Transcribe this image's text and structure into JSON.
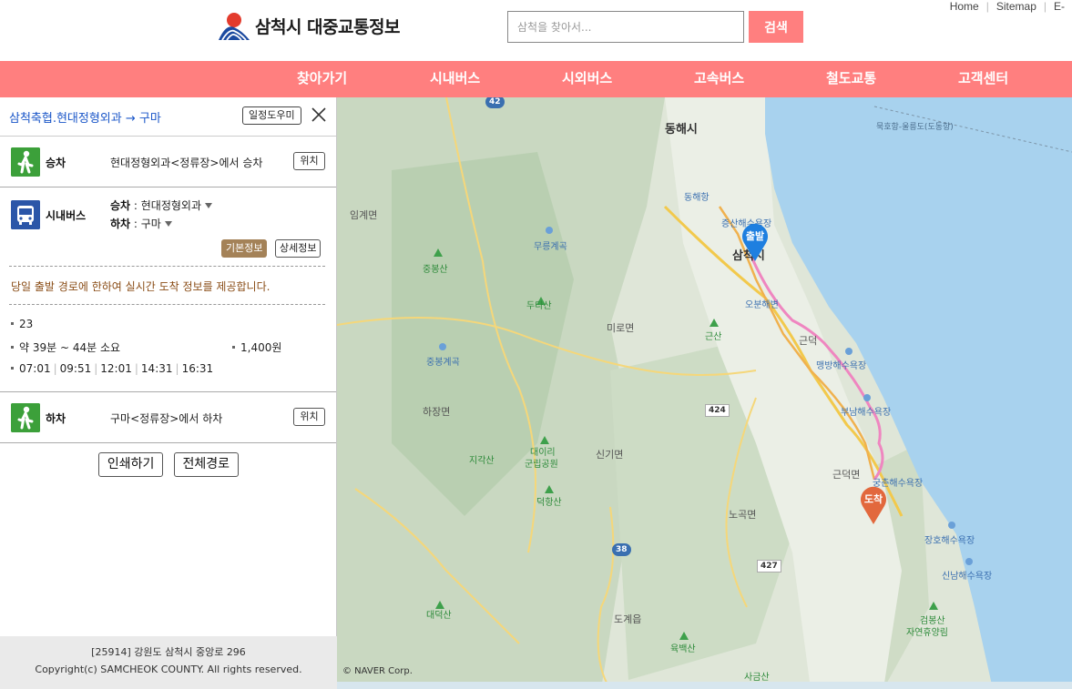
{
  "header": {
    "logo_text": "삼척시 대중교통정보",
    "search_placeholder": "삼척을 찾아서...",
    "search_button": "검색",
    "util_links": [
      "Home",
      "Sitemap",
      "E-"
    ]
  },
  "nav": {
    "items": [
      "찾아가기",
      "시내버스",
      "시외버스",
      "고속버스",
      "철도교통",
      "고객센터"
    ]
  },
  "panel": {
    "route_title": "삼척축협.현대정형외과 → 구마",
    "helper_button": "일정도우미",
    "board": {
      "label": "승차",
      "desc": "현대정형외과<정류장>에서 승차",
      "pos_button": "위치"
    },
    "bus": {
      "label": "시내버스",
      "board_key": "승차",
      "board_stop": "현대정형외과",
      "alight_key": "하차",
      "alight_stop": "구마",
      "basic_info_button": "기본정보",
      "detail_info_button": "상세정보",
      "notice": "당일 출발 경로에 한하여 실시간 도착 정보를 제공합니다.",
      "route_no": "23",
      "duration": "약 39분 ~ 44분 소요",
      "fare": "1,400원",
      "times": [
        "07:01",
        "09:51",
        "12:01",
        "14:31",
        "16:31"
      ]
    },
    "alight": {
      "label": "하차",
      "desc": "구마<정류장>에서 하차",
      "pos_button": "위치"
    },
    "print_button": "인쇄하기",
    "full_route_button": "전체경로",
    "footer_address": "[25914] 강원도 삼척시 중앙로 296",
    "footer_copyright": "Copyright(c) SAMCHEOK COUNTY. All rights reserved."
  },
  "map": {
    "start_marker": "출발",
    "end_marker": "도착",
    "credit": "© NAVER Corp.",
    "labels": {
      "donghae": "동해시",
      "samcheok": "삼척시",
      "imgye": "임계면",
      "mihoro": "미로면",
      "hajang": "하장면",
      "singi": "신기면",
      "geundeok": "근덕면",
      "nogok": "노곡면",
      "dogye": "도계읍",
      "ferry": "묵호항-울릉도(도동항)",
      "donghae_port": "동해항",
      "jeungsan_beach": "증산해수욕장",
      "mureung": "무릉계곡",
      "jungbong_valley": "중봉계곡",
      "obun": "오분해변",
      "maengbang": "맹방해수욕장",
      "bunam": "부남해수욕장",
      "gungchon": "궁촌해수욕장",
      "jangho": "장호해수욕장",
      "sinnam": "신남해수욕장",
      "geundeok_ic": "근덕",
      "junbongsan": "중봉산",
      "dutasan": "두타산",
      "geunsan": "근산",
      "jigaksan": "지각산",
      "daeri": "대이리",
      "gunrip": "군립공원",
      "deokhangsan": "덕항산",
      "daedeoksan": "대덕산",
      "yukbaeksan": "육백산",
      "sageumsan": "사금산",
      "geombongsan": "검봉산",
      "forest": "자연휴양림"
    },
    "road_shields": [
      "42",
      "424",
      "38",
      "427"
    ]
  }
}
